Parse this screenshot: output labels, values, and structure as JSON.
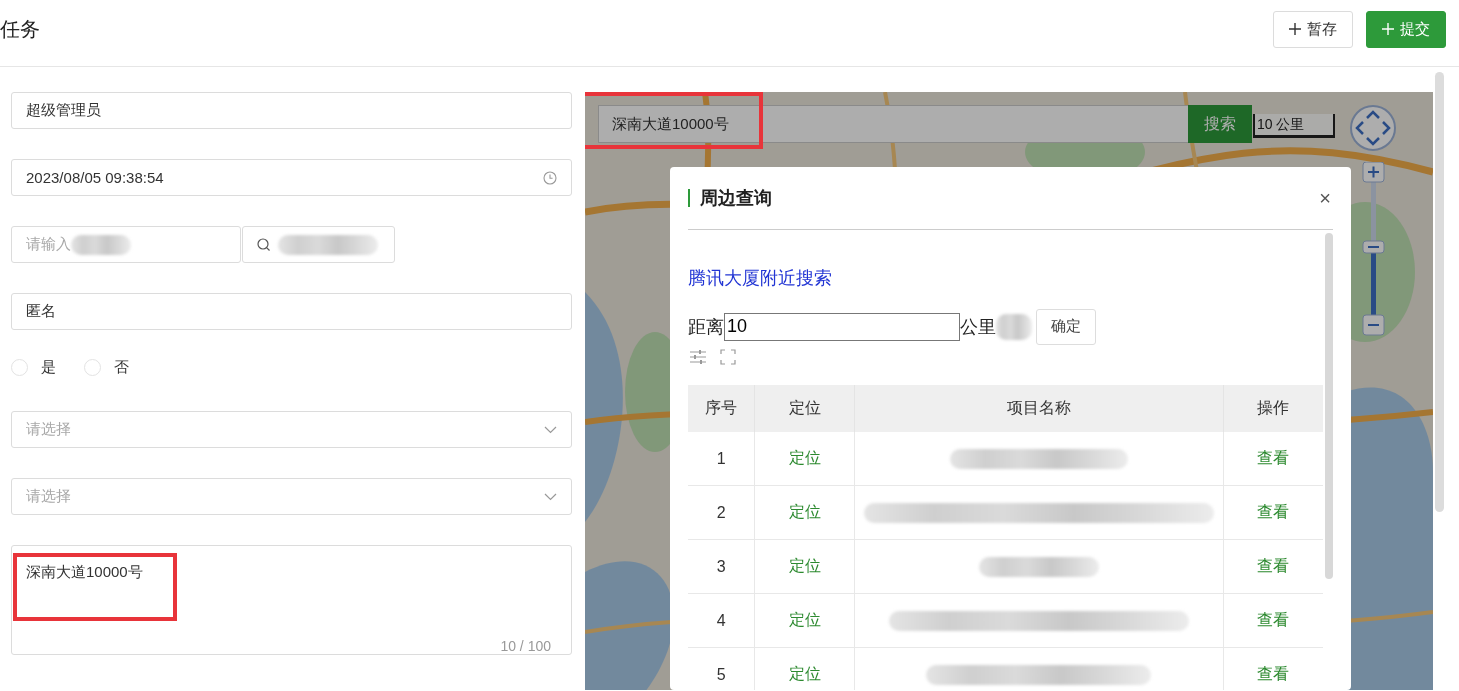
{
  "page": {
    "title": "任务"
  },
  "actions": [
    {
      "label": "暂存",
      "kind": "default"
    },
    {
      "label": "提交",
      "kind": "primary"
    }
  ],
  "form": {
    "fields": [
      {
        "kind": "text",
        "value": "超级管理员"
      },
      {
        "kind": "datetime",
        "value": "2023/08/05 09:38:54"
      },
      {
        "kind": "search-pair",
        "placeholder": "请输入"
      },
      {
        "kind": "text",
        "value": "匿名"
      },
      {
        "kind": "radio",
        "options": [
          {
            "label": "是",
            "selected": false
          },
          {
            "label": "否",
            "selected": false
          }
        ]
      },
      {
        "kind": "select",
        "placeholder": "请选择"
      },
      {
        "kind": "select",
        "placeholder": "请选择"
      },
      {
        "kind": "textarea",
        "value": "深南大道10000号",
        "counter": "10 / 100",
        "highlighted": true
      }
    ]
  },
  "map": {
    "search_value": "深南大道10000号",
    "highlighted": true,
    "search_button": "搜索",
    "scale": "10 公里"
  },
  "dialog": {
    "title": "周边查询",
    "close": "×",
    "link": "腾讯大厦附近搜索",
    "distance_label": "距离",
    "distance_value": "10",
    "unit": "公里",
    "confirm": "确定",
    "table": {
      "columns": [
        "序号",
        "定位",
        "项目名称",
        "操作"
      ],
      "rows": [
        {
          "index": "1",
          "locate": "定位",
          "action": "查看"
        },
        {
          "index": "2",
          "locate": "定位",
          "action": "查看"
        },
        {
          "index": "3",
          "locate": "定位",
          "action": "查看"
        },
        {
          "index": "4",
          "locate": "定位",
          "action": "查看"
        },
        {
          "index": "5",
          "locate": "定位",
          "action": "查看"
        }
      ]
    }
  }
}
